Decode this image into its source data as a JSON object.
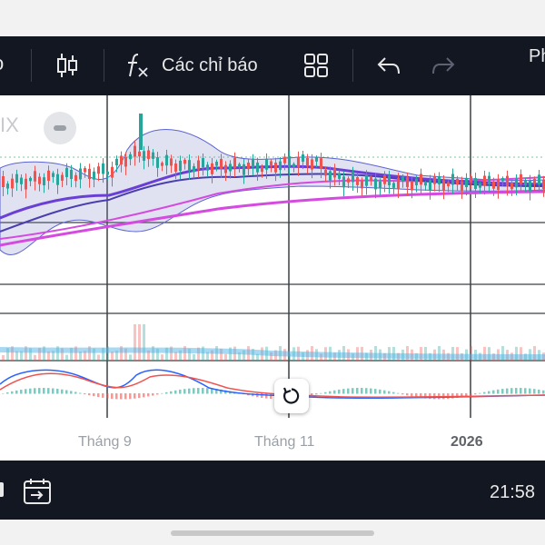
{
  "toolbar": {
    "edge_text": "o",
    "indicators_label": "Các chỉ báo",
    "right_cut_label": "Ph"
  },
  "chart": {
    "watermark_text": "IX",
    "x_labels": [
      "Tháng 9",
      "Tháng 11",
      "2026"
    ]
  },
  "bottombar": {
    "clock": "21:58"
  },
  "colors": {
    "toolbar_bg": "#131722",
    "up": "#26a69a",
    "down": "#ef5350",
    "ma_purple": "#6a3fd6",
    "ma_magenta": "#d54be0",
    "bollinger": "#5b63d3",
    "volume_ma": "#4fb3e8",
    "macd_line": "#2962ff",
    "signal_line": "#ef5350"
  },
  "icons": [
    "candlestick-icon",
    "function-fx-icon",
    "layout-grid-icon",
    "undo-icon",
    "redo-icon",
    "calendar-goto-icon",
    "reset-rotate-icon"
  ]
}
